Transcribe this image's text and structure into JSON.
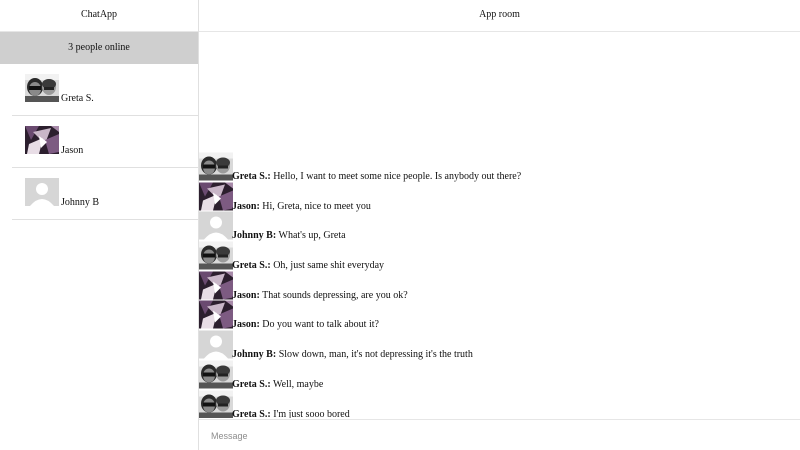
{
  "sidebar": {
    "app_title": "ChatApp",
    "online_status": "3 people online",
    "contacts": [
      {
        "name": "Greta S.",
        "avatar": "couple-photo-avatar"
      },
      {
        "name": "Jason",
        "avatar": "abstract-art-avatar"
      },
      {
        "name": "Johnny B",
        "avatar": "default-user-avatar"
      }
    ]
  },
  "room": {
    "title": "App room",
    "messages": [
      {
        "author": "Greta S.:",
        "text": " Hello, I want to meet some nice people. Is anybody out there?"
      },
      {
        "author": "Jason:",
        "text": " Hi, Greta, nice to meet you"
      },
      {
        "author": "Johnny B:",
        "text": " What's up, Greta"
      },
      {
        "author": "Greta S.:",
        "text": " Oh, just same shit everyday"
      },
      {
        "author": "Jason:",
        "text": " That sounds depressing, are you ok?"
      },
      {
        "author": "Jason:",
        "text": " Do you want to talk about it?"
      },
      {
        "author": "Johnny B:",
        "text": " Slow down, man, it's not depressing it's the truth"
      },
      {
        "author": "Greta S.:",
        "text": " Well, maybe"
      },
      {
        "author": "Greta S.:",
        "text": " I'm just sooo bored"
      }
    ],
    "composer": {
      "placeholder": "Message",
      "value": ""
    }
  }
}
